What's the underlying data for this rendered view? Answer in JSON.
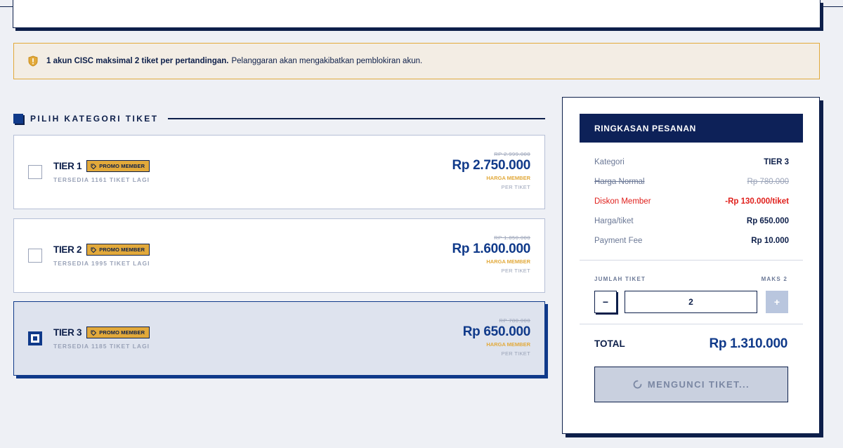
{
  "alert": {
    "bold": "1 akun CISC maksimal 2 tiket per pertandingan.",
    "text": "Pelanggaran akan mengakibatkan pemblokiran akun."
  },
  "section": {
    "title": "PILIH KATEGORI TIKET"
  },
  "tiers": [
    {
      "name": "TIER 1",
      "badge": "PROMO MEMBER",
      "available": "TERSEDIA 1161 TIKET LAGI",
      "old_price": "RP 2.999.000",
      "price": "Rp 2.750.000",
      "member_label": "HARGA MEMBER",
      "per_label": "PER TIKET",
      "selected": false
    },
    {
      "name": "TIER 2",
      "badge": "PROMO MEMBER",
      "available": "TERSEDIA 1995 TIKET LAGI",
      "old_price": "RP 1.850.000",
      "price": "Rp 1.600.000",
      "member_label": "HARGA MEMBER",
      "per_label": "PER TIKET",
      "selected": false
    },
    {
      "name": "TIER 3",
      "badge": "PROMO MEMBER",
      "available": "TERSEDIA 1185 TIKET LAGI",
      "old_price": "RP 780.000",
      "price": "Rp 650.000",
      "member_label": "HARGA MEMBER",
      "per_label": "PER TIKET",
      "selected": true
    }
  ],
  "summary": {
    "title": "RINGKASAN PESANAN",
    "rows": [
      {
        "key": "Kategori",
        "value": "TIER 3"
      },
      {
        "key": "Harga Normal",
        "value": "Rp 780.000"
      },
      {
        "key": "Diskon Member",
        "value": "-Rp 130.000/tiket"
      },
      {
        "key": "Harga/tiket",
        "value": "Rp 650.000"
      },
      {
        "key": "Payment Fee",
        "value": "Rp 10.000"
      }
    ],
    "qty_label": "JUMLAH TIKET",
    "qty_max": "MAKS 2",
    "qty_minus": "−",
    "qty_plus": "+",
    "qty_value": "2",
    "total_label": "TOTAL",
    "total_value": "Rp 1.310.000",
    "button_label": "MENGUNCI TIKET..."
  },
  "colors": {
    "navy": "#0d1f4a",
    "primary": "#103a8a",
    "accent": "#e2a93a",
    "danger": "#e0201c"
  },
  "icons": {
    "alert": "shield-icon",
    "badge": "tag-icon",
    "button": "spinner-icon"
  }
}
